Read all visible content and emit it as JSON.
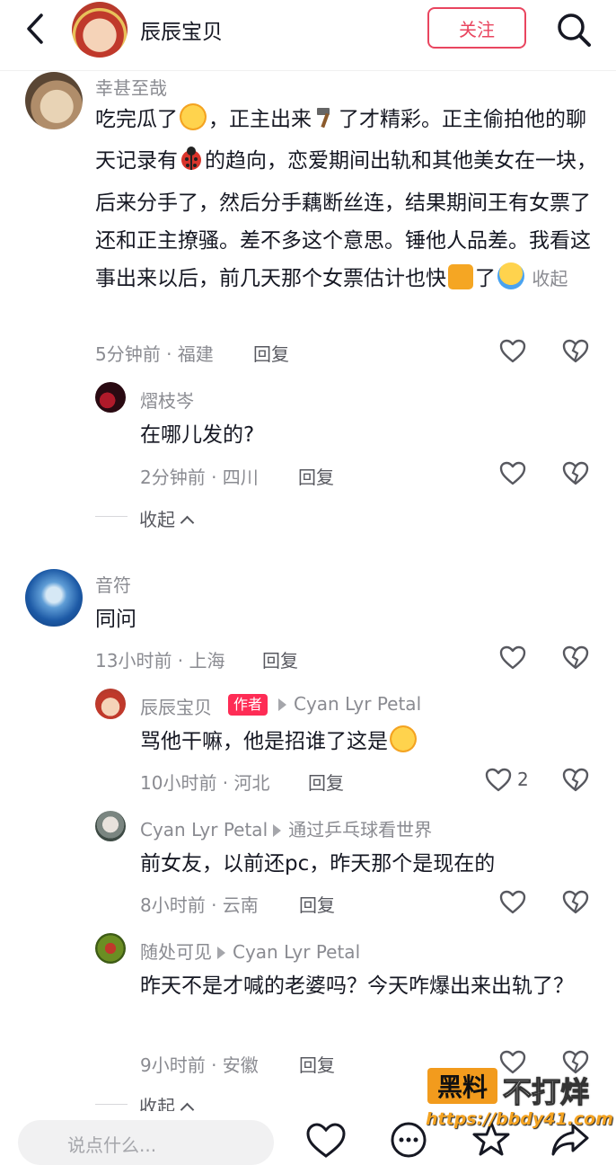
{
  "header": {
    "title": "辰辰宝贝",
    "follow_label": "关注"
  },
  "comments": [
    {
      "user": "幸甚至哉",
      "text_parts": [
        "吃完瓜了",
        "，正主出来",
        "了才精彩。正主偷拍他的聊天记录有",
        "的趋向，恋爱期间出轨和其他美女在一块，后来分手了，然后分手藕断丝连，结果期间王有女票了还和正主撩骚。差不多这个意思。锤他人品差。我看这事出来以后，前几天那个女票估计也快",
        "了",
        " 收起"
      ],
      "meta": "5分钟前 · 福建",
      "reply": "回复",
      "replies": [
        {
          "user": "熠枝岑",
          "text": "在哪儿发的?",
          "meta": "2分钟前 · 四川",
          "reply": "回复"
        }
      ],
      "collapse": "收起"
    },
    {
      "user": "音符",
      "text": "同问",
      "meta": "13小时前 · 上海",
      "reply": "回复",
      "replies": [
        {
          "user": "辰辰宝贝",
          "badge": "作者",
          "reply_to": "Cyan Lyr Petal",
          "text": "骂他干嘛，他是招谁了这是",
          "meta": "10小时前 · 河北",
          "reply": "回复",
          "likes": "2"
        },
        {
          "user": "Cyan Lyr Petal",
          "reply_to": "通过乒乓球看世界",
          "text": "前女友，以前还pc，昨天那个是现在的",
          "meta": "8小时前 · 云南",
          "reply": "回复"
        },
        {
          "user": "随处可见",
          "reply_to": "Cyan Lyr Petal",
          "text": "昨天不是才喊的老婆吗？今天咋爆出来出轨了？",
          "meta": "9小时前 · 安徽",
          "reply": "回复"
        }
      ],
      "collapse": "收起"
    }
  ],
  "bottom": {
    "input_placeholder": "说点什么..."
  },
  "watermark": {
    "box": "黑料",
    "text": "不打烊",
    "url": "https://bbdy41.com"
  }
}
